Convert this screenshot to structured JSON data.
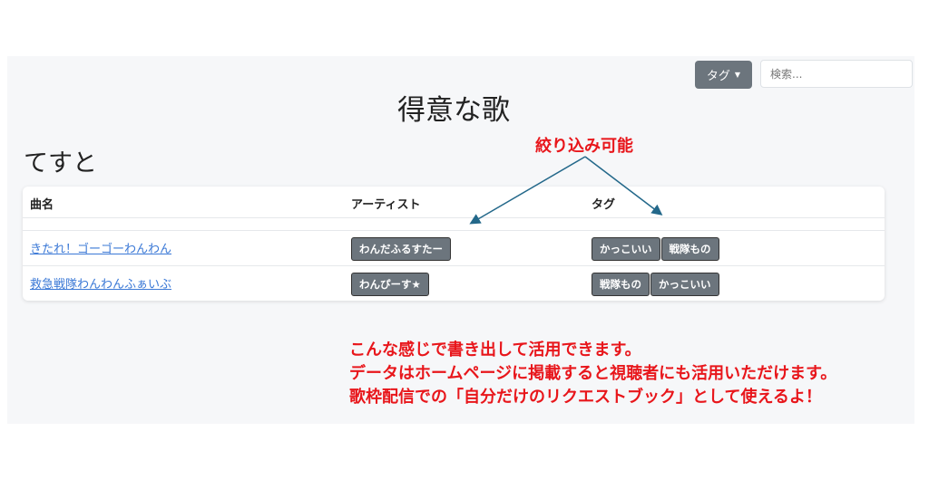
{
  "toolbar": {
    "tag_label": "タグ",
    "search_placeholder": "検索..."
  },
  "page_title": "得意な歌",
  "section_title": "てすと",
  "table": {
    "headers": [
      "曲名",
      "アーティスト",
      "タグ"
    ],
    "rows": [
      {
        "song": "きたれ！ゴーゴーわんわん",
        "artist": "わんだふるすたー",
        "tags": [
          "かっこいい",
          "戦隊もの"
        ]
      },
      {
        "song": "救急戦隊わんわんふぁいぶ",
        "artist": "わんぴーす★",
        "tags": [
          "戦隊もの",
          "かっこいい"
        ]
      }
    ]
  },
  "annotation": {
    "filter_note": "絞り込み可能",
    "lines": [
      "こんな感じで書き出して活用できます。",
      "データはホームページに掲載すると視聴者にも活用いただけます。",
      "歌枠配信での「自分だけのリクエストブック」として使えるよ！"
    ],
    "color": "#e8161b"
  }
}
